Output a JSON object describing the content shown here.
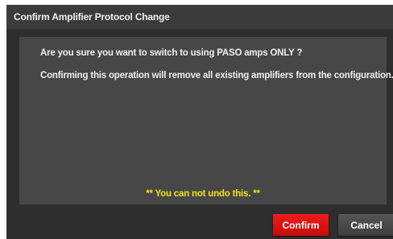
{
  "dialog": {
    "title": "Confirm Amplifier Protocol Change",
    "question": "Are you sure you want to switch to using PASO amps ONLY ?",
    "detail": "Confirming this operation will remove all existing amplifiers from the configuration.",
    "warning": "** You can not undo this. **"
  },
  "buttons": {
    "confirm_label": "Confirm",
    "cancel_label": "Cancel"
  },
  "colors": {
    "confirm": "#e01414",
    "warning_text": "#f2e21a",
    "dialog_bg": "#2e2e2e",
    "content_bg": "#474747"
  }
}
